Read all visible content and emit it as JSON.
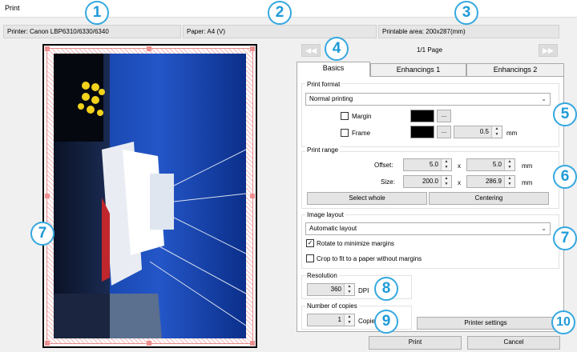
{
  "window": {
    "title": "Print"
  },
  "status": {
    "printer": "Printer: Canon LBP6310/6330/6340",
    "paper": "Paper: A4 (V)",
    "printable_area": "Printable area: 200x287(mm)"
  },
  "callouts": [
    "1",
    "2",
    "3",
    "4",
    "5",
    "6",
    "7",
    "7",
    "8",
    "9",
    "10"
  ],
  "nav": {
    "prev_icon": "double-left-arrow",
    "next_icon": "double-right-arrow",
    "prev_glyph": "◀◀",
    "next_glyph": "▶▶",
    "page_info": "1/1 Page"
  },
  "tabs": [
    {
      "label": "Basics",
      "active": true
    },
    {
      "label": "Enhancings 1",
      "active": false
    },
    {
      "label": "Enhancings 2",
      "active": false
    }
  ],
  "print_format": {
    "group_label": "Print format",
    "mode": "Normal printing",
    "margin_label": "Margin",
    "margin_checked": false,
    "frame_label": "Frame",
    "frame_checked": false,
    "dots": "...",
    "frame_width": "0.5",
    "unit": "mm",
    "margin_color": "#000000",
    "frame_color": "#000000"
  },
  "print_range": {
    "group_label": "Print range",
    "offset_label": "Offset:",
    "offset_x": "5.0",
    "offset_y": "5.0",
    "size_label": "Size:",
    "size_x": "200.0",
    "size_y": "286.9",
    "times": "x",
    "unit": "mm",
    "select_whole": "Select whole",
    "centering": "Centering"
  },
  "image_layout": {
    "group_label": "Image layout",
    "mode": "Automatic layout",
    "rotate_label": "Rotate to minimize margins",
    "rotate_checked": true,
    "crop_label": "Crop to fit to a paper without margins",
    "crop_checked": false
  },
  "resolution": {
    "group_label": "Resolution",
    "value": "360",
    "unit": "DPI"
  },
  "copies": {
    "group_label": "Number of copies",
    "value": "1",
    "unit": "Copies"
  },
  "printer_settings": "Printer settings",
  "footer": {
    "print": "Print",
    "cancel": "Cancel"
  },
  "colors": {
    "accent": "#35a8e0",
    "hatch": "#f7b6b6",
    "sky": "#1f49b8"
  }
}
